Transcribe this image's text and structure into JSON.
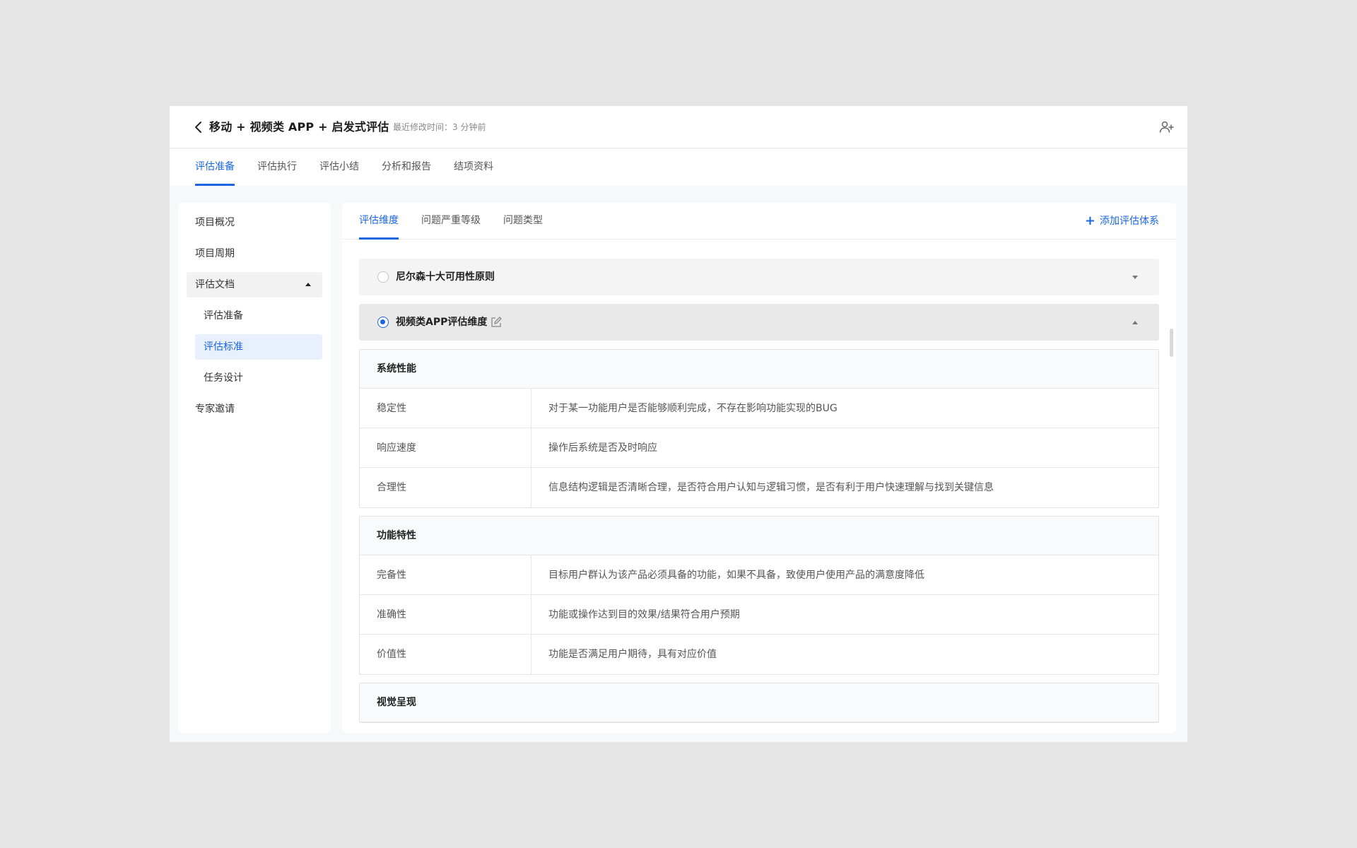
{
  "header": {
    "title": "移动 + 视频类 APP + 启发式评估",
    "modified": "最近修改时间：3 分钟前"
  },
  "topnav": {
    "tabs": [
      {
        "label": "评估准备",
        "active": true
      },
      {
        "label": "评估执行"
      },
      {
        "label": "评估小结"
      },
      {
        "label": "分析和报告"
      },
      {
        "label": "结项资料"
      }
    ]
  },
  "sidebar": {
    "items": [
      {
        "label": "项目概况"
      },
      {
        "label": "项目周期"
      },
      {
        "label": "评估文档",
        "expanded": true
      },
      {
        "label": "评估准备"
      },
      {
        "label": "评估标准",
        "selected": true
      },
      {
        "label": "任务设计"
      },
      {
        "label": "专家邀请"
      }
    ]
  },
  "subtabs": {
    "tabs": [
      {
        "label": "评估维度",
        "active": true
      },
      {
        "label": "问题严重等级"
      },
      {
        "label": "问题类型"
      }
    ],
    "add_label": "添加评估体系"
  },
  "systems": [
    {
      "label": "尼尔森十大可用性原则",
      "selected": false
    },
    {
      "label": "视频类APP评估维度",
      "selected": true
    }
  ],
  "sections": [
    {
      "title": "系统性能",
      "rows": [
        {
          "k": "稳定性",
          "v": "对于某一功能用户是否能够顺利完成，不存在影响功能实现的BUG"
        },
        {
          "k": "响应速度",
          "v": "操作后系统是否及时响应"
        },
        {
          "k": "合理性",
          "v": "信息结构逻辑是否清晰合理，是否符合用户认知与逻辑习惯，是否有利于用户快速理解与找到关键信息"
        }
      ]
    },
    {
      "title": "功能特性",
      "rows": [
        {
          "k": "完备性",
          "v": "目标用户群认为该产品必须具备的功能，如果不具备，致使用户使用产品的满意度降低"
        },
        {
          "k": "准确性",
          "v": "功能或操作达到目的效果/结果符合用户预期"
        },
        {
          "k": "价值性",
          "v": "功能是否满足用户期待，具有对应价值"
        }
      ]
    },
    {
      "title": "视觉呈现",
      "rows": []
    }
  ]
}
